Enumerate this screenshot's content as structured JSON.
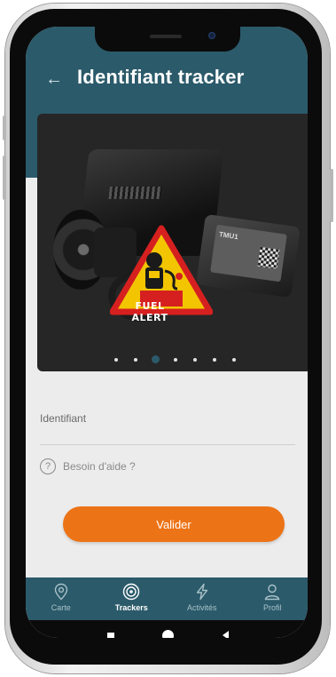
{
  "header": {
    "title": "Identifiant tracker",
    "back_icon": "arrow-left-icon",
    "background": "#2b5a6a"
  },
  "product_image": {
    "sign_text": "FUEL ALERT",
    "module_text": "TMU1",
    "carousel": {
      "total": 7,
      "active_index": 2
    }
  },
  "form": {
    "identifier_label": "Identifiant",
    "help_text": "Besoin d'aide ?",
    "help_icon": "question-circle-icon",
    "submit_label": "Valider",
    "submit_color": "#ec7316"
  },
  "tabs": [
    {
      "label": "Carte",
      "icon": "map-pin-icon",
      "active": false
    },
    {
      "label": "Trackers",
      "icon": "signal-icon",
      "active": true
    },
    {
      "label": "Activités",
      "icon": "lightning-icon",
      "active": false
    },
    {
      "label": "Profil",
      "icon": "user-icon",
      "active": false
    }
  ]
}
